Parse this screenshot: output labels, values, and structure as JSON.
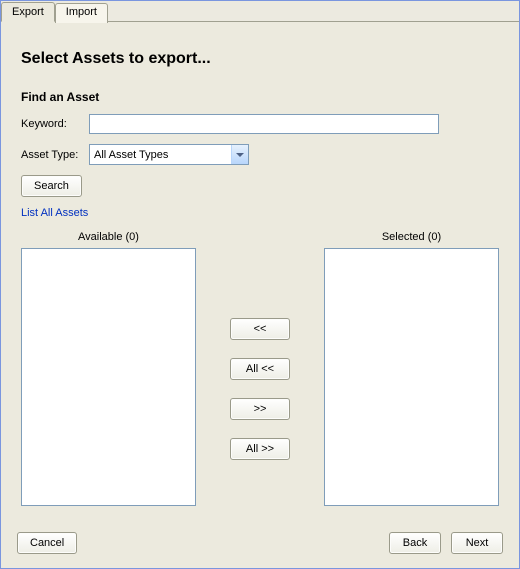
{
  "tabs": {
    "export": "Export",
    "import": "Import",
    "active": "export"
  },
  "page_title": "Select Assets to export...",
  "find": {
    "header": "Find an Asset",
    "keyword_label": "Keyword:",
    "keyword_value": "",
    "type_label": "Asset Type:",
    "type_value": "All Asset Types",
    "search_button": "Search",
    "list_all_link": "List All Assets"
  },
  "lists": {
    "available_label": "Available (0)",
    "selected_label": "Selected (0)"
  },
  "transfer": {
    "remove": "<<",
    "remove_all": "All <<",
    "add": ">>",
    "add_all": "All >>"
  },
  "footer": {
    "cancel": "Cancel",
    "back": "Back",
    "next": "Next"
  }
}
